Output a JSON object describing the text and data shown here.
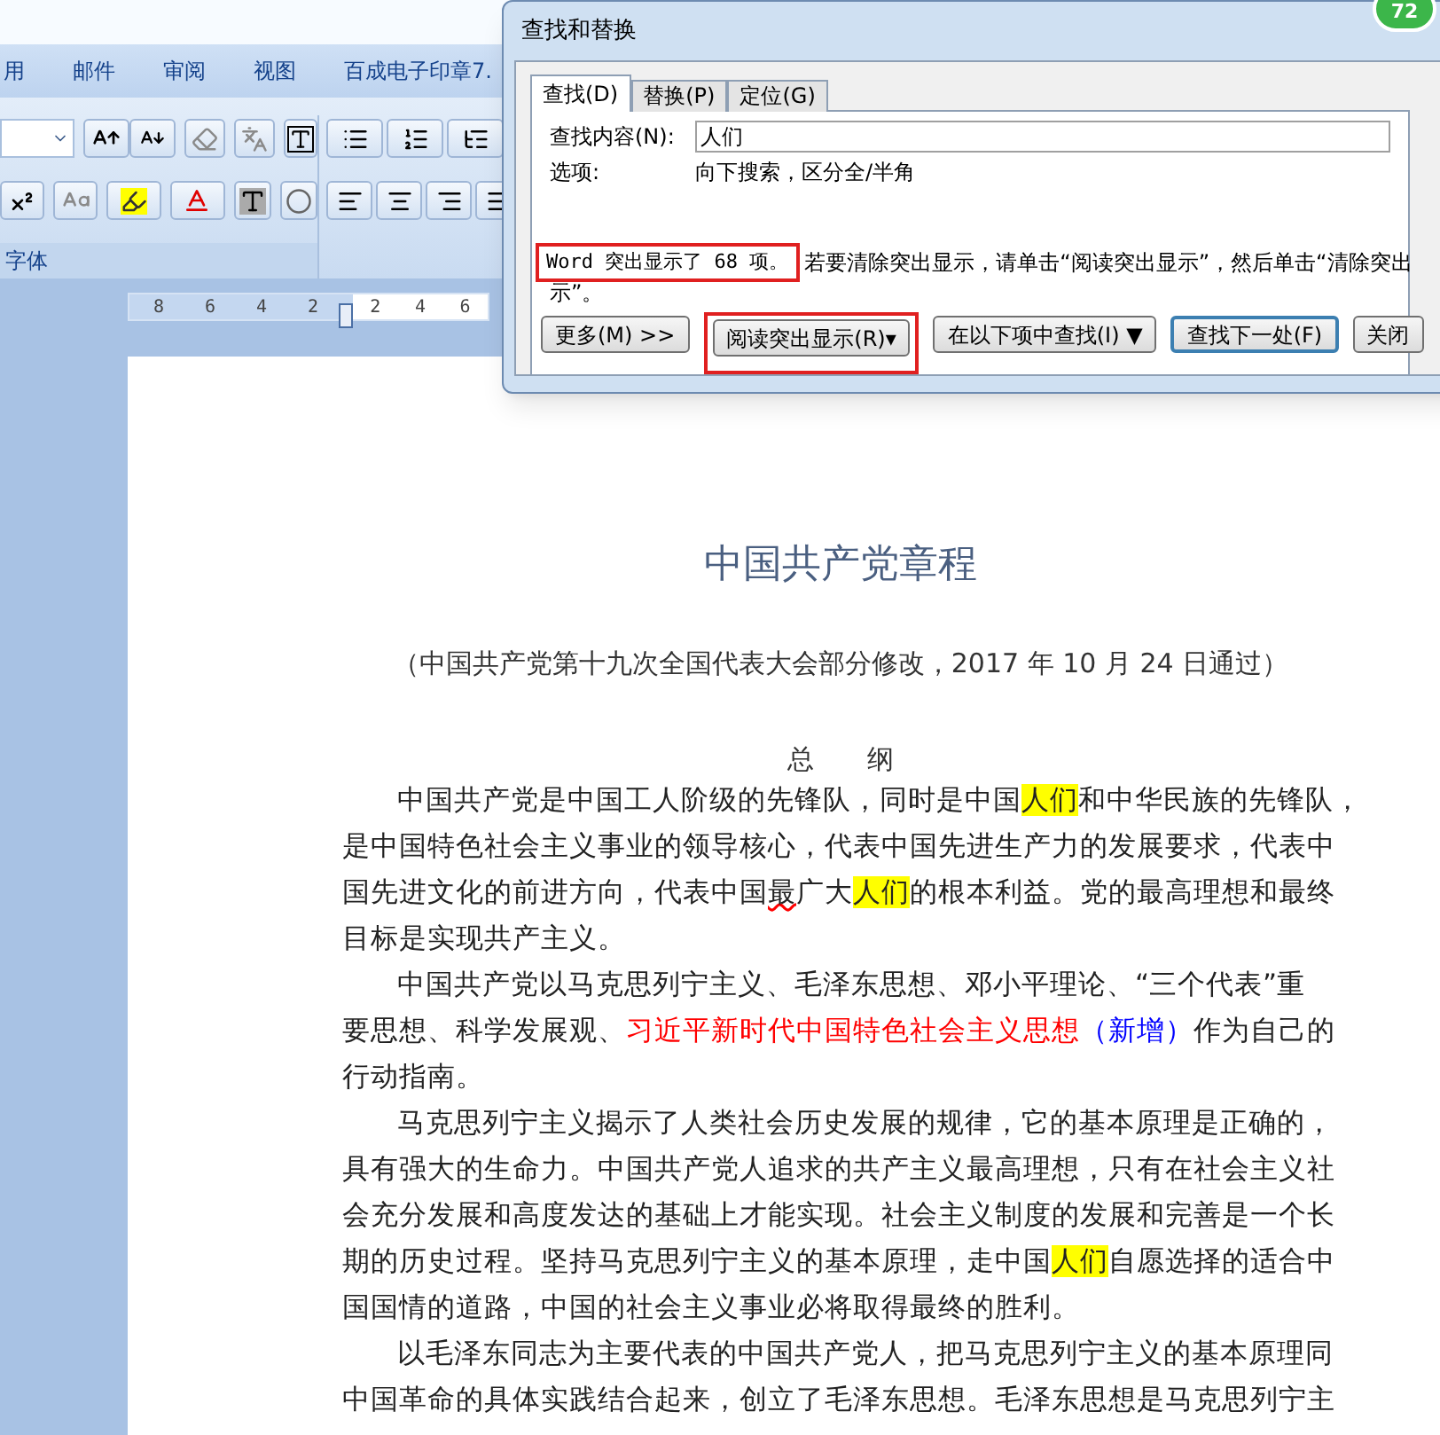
{
  "ribbon": {
    "tabs": [
      "用",
      "邮件",
      "审阅",
      "视图",
      "百成电子印章7."
    ],
    "group_label": "字体"
  },
  "ruler": {
    "left_labels": [
      "8",
      "6",
      "4",
      "2"
    ],
    "right_labels": [
      "2",
      "4",
      "6"
    ]
  },
  "document": {
    "title": "中国共产党章程",
    "subtitle": "（中国共产党第十九次全国代表大会部分修改，2017 年 10 月 24 日通过）",
    "section_heading": "总　　纲",
    "paragraphs": [
      {
        "lines": [
          [
            {
              "text": "中国共产党是中国工人阶级的先锋队，同时是中国",
              "kind": "plain"
            },
            {
              "text": "人们",
              "kind": "highlight"
            },
            {
              "text": "和中华民族的先锋队，",
              "kind": "plain"
            }
          ],
          [
            {
              "text": "是中国特色社会主义事业的领导核心，代表中国先进生产力的发展要求，代表中",
              "kind": "plain"
            }
          ],
          [
            {
              "text": "国先进文化的前进方向，代表中国",
              "kind": "plain"
            },
            {
              "text": "最",
              "kind": "misspelled"
            },
            {
              "text": "广大",
              "kind": "plain"
            },
            {
              "text": "人们",
              "kind": "highlight"
            },
            {
              "text": "的根本利益。党的最高理想和最终",
              "kind": "plain"
            }
          ],
          [
            {
              "text": "目标是实现共产主义。",
              "kind": "plain"
            }
          ]
        ]
      },
      {
        "lines": [
          [
            {
              "text": "中国共产党以马克思列宁主义、毛泽东思想、邓小平理论、“三个代表”重",
              "kind": "plain"
            }
          ],
          [
            {
              "text": "要思想、科学发展观、",
              "kind": "plain"
            },
            {
              "text": "习近平新时代中国特色社会主义思想",
              "kind": "red"
            },
            {
              "text": "（新增）",
              "kind": "blue"
            },
            {
              "text": "作为自己的",
              "kind": "plain"
            }
          ],
          [
            {
              "text": "行动指南。",
              "kind": "plain"
            }
          ]
        ]
      },
      {
        "lines": [
          [
            {
              "text": "马克思列宁主义揭示了人类社会历史发展的规律，它的基本原理是正确的，",
              "kind": "plain"
            }
          ],
          [
            {
              "text": "具有强大的生命力。中国共产党人追求的共产主义最高理想，只有在社会主义社",
              "kind": "plain"
            }
          ],
          [
            {
              "text": "会充分发展和高度发达的基础上才能实现。社会主义制度的发展和完善是一个长",
              "kind": "plain"
            }
          ],
          [
            {
              "text": "期的历史过程。坚持马克思列宁主义的基本原理，走中国",
              "kind": "plain"
            },
            {
              "text": "人们",
              "kind": "highlight"
            },
            {
              "text": "自愿选择的适合中",
              "kind": "plain"
            }
          ],
          [
            {
              "text": "国国情的道路，中国的社会主义事业必将取得最终的胜利。",
              "kind": "plain"
            }
          ]
        ]
      },
      {
        "lines": [
          [
            {
              "text": "以毛泽东同志为主要代表的中国共产党人，把马克思列宁主义的基本原理同",
              "kind": "plain"
            }
          ],
          [
            {
              "text": "中国革命的具体实践结合起来，创立了毛泽东思想。毛泽东思想是马克思列宁主",
              "kind": "plain"
            }
          ]
        ]
      }
    ]
  },
  "dialog": {
    "title": "查找和替换",
    "tabs": [
      {
        "label": "查找(D)",
        "selected": true
      },
      {
        "label": "替换(P)",
        "selected": false
      },
      {
        "label": "定位(G)",
        "selected": false
      }
    ],
    "find_label": "查找内容(N):",
    "find_value": "人们",
    "options_label": "选项:",
    "options_value": "向下搜索，区分全/半角",
    "message_count": "Word 突出显示了 68 项。",
    "message_rest": "若要清除突出显示，请单击“阅读突出显示”，然后单击“清除突出",
    "message_wrap": "示”。",
    "buttons": [
      {
        "label": "更多(M) >>",
        "kind": "plain",
        "annotated": false
      },
      {
        "label": "阅读突出显示(R)▾",
        "kind": "plain",
        "annotated": true
      },
      {
        "label": "在以下项中查找(I) ▼",
        "kind": "plain",
        "annotated": false
      },
      {
        "label": "查找下一处(F)",
        "kind": "default",
        "annotated": false
      },
      {
        "label": "关闭",
        "kind": "plain",
        "annotated": false
      }
    ]
  },
  "badge": "72"
}
